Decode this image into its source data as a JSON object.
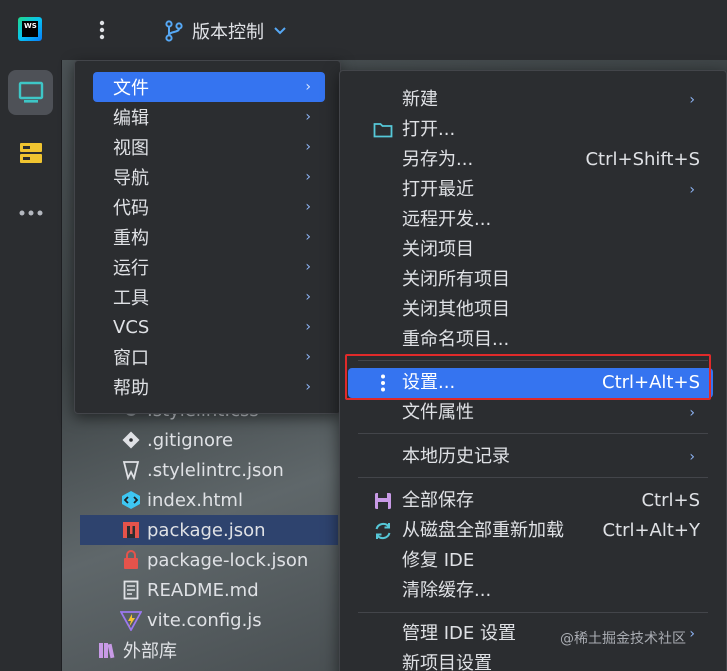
{
  "toolbar": {
    "logo_text": "WS",
    "vcs_label": "版本控制"
  },
  "tree": {
    "items": [
      {
        "label": ".stylelint.css",
        "icon": "css-file-icon"
      },
      {
        "label": ".gitignore",
        "icon": "git-icon"
      },
      {
        "label": ".stylelintrc.json",
        "icon": "stylelint-icon"
      },
      {
        "label": "index.html",
        "icon": "html-file-icon"
      },
      {
        "label": "package.json",
        "icon": "npm-icon"
      },
      {
        "label": "package-lock.json",
        "icon": "lock-icon"
      },
      {
        "label": "README.md",
        "icon": "markdown-file-icon"
      },
      {
        "label": "vite.config.js",
        "icon": "vite-icon"
      },
      {
        "label": "外部库",
        "icon": "library-icon"
      }
    ]
  },
  "main_menu": {
    "items": [
      {
        "label": "文件"
      },
      {
        "label": "编辑"
      },
      {
        "label": "视图"
      },
      {
        "label": "导航"
      },
      {
        "label": "代码"
      },
      {
        "label": "重构"
      },
      {
        "label": "运行"
      },
      {
        "label": "工具"
      },
      {
        "label": "VCS"
      },
      {
        "label": "窗口"
      },
      {
        "label": "帮助"
      }
    ]
  },
  "file_menu": {
    "items": [
      {
        "label": "新建",
        "shortcut": ""
      },
      {
        "label": "打开...",
        "shortcut": ""
      },
      {
        "label": "另存为...",
        "shortcut": "Ctrl+Shift+S"
      },
      {
        "label": "打开最近",
        "shortcut": ""
      },
      {
        "label": "远程开发...",
        "shortcut": ""
      },
      {
        "label": "关闭项目",
        "shortcut": ""
      },
      {
        "label": "关闭所有项目",
        "shortcut": ""
      },
      {
        "label": "关闭其他项目",
        "shortcut": ""
      },
      {
        "label": "重命名项目...",
        "shortcut": ""
      },
      {
        "label": "设置...",
        "shortcut": "Ctrl+Alt+S"
      },
      {
        "label": "文件属性",
        "shortcut": ""
      },
      {
        "label": "本地历史记录",
        "shortcut": ""
      },
      {
        "label": "全部保存",
        "shortcut": "Ctrl+S"
      },
      {
        "label": "从磁盘全部重新加载",
        "shortcut": "Ctrl+Alt+Y"
      },
      {
        "label": "修复 IDE",
        "shortcut": ""
      },
      {
        "label": "清除缓存...",
        "shortcut": ""
      },
      {
        "label": "管理 IDE 设置",
        "shortcut": ""
      },
      {
        "label": "新项目设置",
        "shortcut": ""
      }
    ]
  },
  "watermark": "@稀土掘金技术社区"
}
